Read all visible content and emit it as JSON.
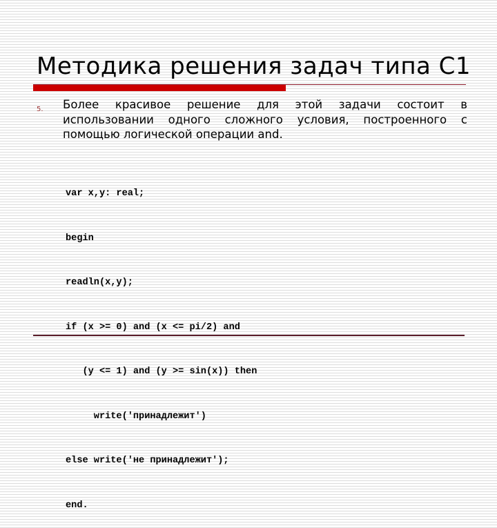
{
  "slide": {
    "title": "Методика решения задач типа С1",
    "colors": {
      "accent_bar": "#cc0000",
      "thin_rule": "#8b1a2a",
      "bottom_rule": "#5a1e2a",
      "list_marker": "#993333",
      "stripe": "#dcdcdc"
    },
    "list_item": {
      "marker": "5.",
      "text": "Более красивое решение для этой задачи состоит в использовании одного сложного условия, построенного с помощью логической операции and."
    },
    "code": {
      "lines": [
        "var x,y: real;",
        "begin",
        "readln(x,y);",
        "if (x >= 0) and (x <= pi/2) and",
        "   (y <= 1) and (y >= sin(x)) then",
        "     write('принадлежит')",
        "else write('не принадлежит');",
        "end."
      ]
    }
  }
}
